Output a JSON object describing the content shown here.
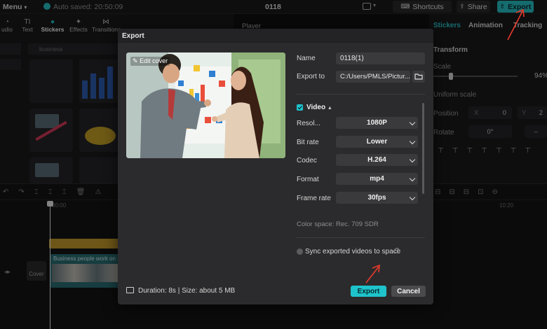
{
  "topbar": {
    "menu_label": "Menu",
    "autosave": "Auto saved: 20:50:09",
    "project_name": "0118",
    "shortcuts_label": "Shortcuts",
    "share_label": "Share",
    "export_label": "Export"
  },
  "left_panel": {
    "tools": [
      {
        "label": "udio",
        "icon": "audio-icon"
      },
      {
        "label": "Text",
        "icon": "text-icon"
      },
      {
        "label": "Stickers",
        "icon": "sticker-icon"
      },
      {
        "label": "Effects",
        "icon": "effects-icon"
      },
      {
        "label": "Transitions",
        "icon": "transitions-icon"
      }
    ],
    "search_placeholder": "business"
  },
  "player": {
    "label": "Player"
  },
  "right_panel": {
    "tabs": [
      "Stickers",
      "Animation",
      "Tracking"
    ],
    "section": "Transform",
    "scale_label": "Scale",
    "scale_value": "94%",
    "uniform_scale_label": "Uniform scale",
    "position_label": "Position",
    "position_x_label": "X",
    "position_x": "0",
    "position_y_label": "Y",
    "position_y": "2",
    "rotate_label": "Rotate",
    "rotate_value": "0°"
  },
  "timeline": {
    "time_start": "00:00",
    "time_mark": "10:20",
    "clip_title": "Business people work on",
    "cover_label": "Cover"
  },
  "dialog": {
    "title": "Export",
    "edit_cover": "Edit cover",
    "name_label": "Name",
    "name_value": "0118(1)",
    "export_to_label": "Export to",
    "export_to_value": "C:/Users/PMLS/Pictur...",
    "video_section": "Video",
    "resolution_label": "Resol...",
    "resolution_value": "1080P",
    "bitrate_label": "Bit rate",
    "bitrate_value": "Lower",
    "codec_label": "Codec",
    "codec_value": "H.264",
    "format_label": "Format",
    "format_value": "mp4",
    "framerate_label": "Frame rate",
    "framerate_value": "30fps",
    "color_space": "Color space: Rec. 709 SDR",
    "sync_label": "Sync exported videos to space",
    "duration_info": "Duration: 8s | Size: about 5 MB",
    "export_button": "Export",
    "cancel_button": "Cancel"
  },
  "colors": {
    "accent": "#1fc3cc",
    "annotation_arrow": "#e8392b"
  }
}
